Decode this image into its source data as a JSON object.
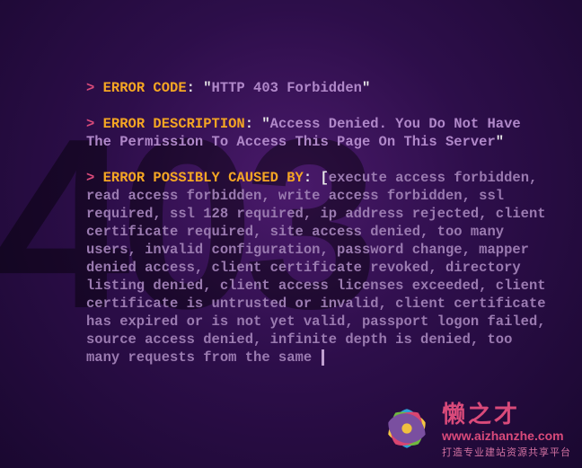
{
  "bg_number": "403",
  "prompt_symbol": "> ",
  "lines": {
    "code": {
      "label": "ERROR CODE",
      "sep": ": \"",
      "msg": "HTTP 403 Forbidden",
      "end": "\""
    },
    "desc": {
      "label": "ERROR DESCRIPTION",
      "sep": ": \"",
      "msg": "Access Denied. You Do Not Have The Permission To Access This Page On This Server",
      "end": "\""
    },
    "cause": {
      "label": "ERROR POSSIBLY CAUSED BY",
      "sep": ": [",
      "msg": "execute access forbidden, read access forbidden, write access forbidden, ssl required, ssl 128 required, ip address rejected, client certificate required, site access denied, too many users, invalid configuration, password change, mapper denied access, client certificate revoked, directory listing denied, client access licenses exceeded, client certificate is untrusted or invalid, client certificate has expired or is not yet valid, passport logon failed, source access denied, infinite depth is denied, too many requests from the same "
    }
  },
  "watermark": {
    "title": "懒之才",
    "url": "www.aizhanzhe.com",
    "subtitle": "打造专业建站资源共享平台"
  }
}
